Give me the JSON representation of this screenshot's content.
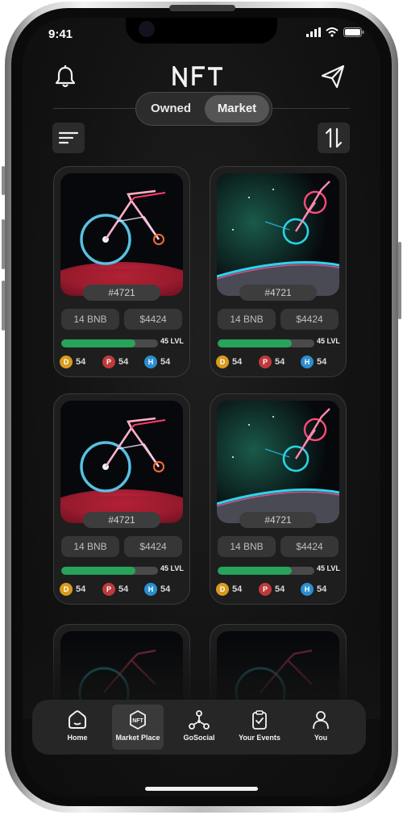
{
  "status": {
    "time": "9:41"
  },
  "header": {
    "logo": "NFT",
    "left_icon": "bell-icon",
    "right_icon": "paper-plane-icon",
    "segments": [
      "Owned",
      "Market"
    ],
    "selected_segment": "Market",
    "filter_icon": "filter-lines-icon",
    "sort_icon": "sort-arrows-icon"
  },
  "cards": [
    {
      "id": "#4721",
      "price_bnb": "14 BNB",
      "price_usd": "$4424",
      "level_fraction": 0.77,
      "level_label": "45 LVL",
      "stats": [
        {
          "letter": "D",
          "value": "54"
        },
        {
          "letter": "P",
          "value": "54"
        },
        {
          "letter": "H",
          "value": "54"
        }
      ],
      "art": "bike-on-rock"
    },
    {
      "id": "#4721",
      "price_bnb": "14 BNB",
      "price_usd": "$4424",
      "level_fraction": 0.77,
      "level_label": "45 LVL",
      "stats": [
        {
          "letter": "D",
          "value": "54"
        },
        {
          "letter": "P",
          "value": "54"
        },
        {
          "letter": "H",
          "value": "54"
        }
      ],
      "art": "bike-flying"
    },
    {
      "id": "#4721",
      "price_bnb": "14 BNB",
      "price_usd": "$4424",
      "level_fraction": 0.77,
      "level_label": "45 LVL",
      "stats": [
        {
          "letter": "D",
          "value": "54"
        },
        {
          "letter": "P",
          "value": "54"
        },
        {
          "letter": "H",
          "value": "54"
        }
      ],
      "art": "bike-on-rock"
    },
    {
      "id": "#4721",
      "price_bnb": "14 BNB",
      "price_usd": "$4424",
      "level_fraction": 0.77,
      "level_label": "45 LVL",
      "stats": [
        {
          "letter": "D",
          "value": "54"
        },
        {
          "letter": "P",
          "value": "54"
        },
        {
          "letter": "H",
          "value": "54"
        }
      ],
      "art": "bike-flying"
    }
  ],
  "tabbar": [
    {
      "label": "Home",
      "icon": "home-icon",
      "active": false
    },
    {
      "label": "Market Place",
      "icon": "nft-badge-icon",
      "active": true
    },
    {
      "label": "GoSocial",
      "icon": "network-icon",
      "active": false
    },
    {
      "label": "Your Events",
      "icon": "clipboard-check-icon",
      "active": false
    },
    {
      "label": "You",
      "icon": "user-icon",
      "active": false
    }
  ],
  "colors": {
    "accent_green": "#27a35a",
    "dot_d": "#d99a1d",
    "dot_p": "#c0393b",
    "dot_h": "#2a8fd0"
  }
}
